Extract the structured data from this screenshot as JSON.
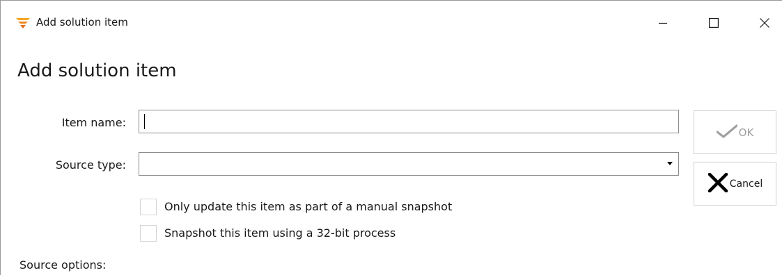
{
  "window": {
    "title": "Add solution item",
    "app_icon": "solarwinds-logo-icon",
    "controls": {
      "minimize": "minimize-icon",
      "maximize": "maximize-icon",
      "close": "close-icon"
    }
  },
  "dialog": {
    "heading": "Add solution item"
  },
  "form": {
    "item_name_label": "Item name:",
    "item_name_value": "",
    "source_type_label": "Source type:",
    "source_type_value": "",
    "checkbox_manual_snapshot": {
      "label": "Only update this item as part of a manual snapshot",
      "checked": false
    },
    "checkbox_32bit": {
      "label": "Snapshot this item using a 32-bit process",
      "checked": false
    },
    "source_options_label": "Source options:"
  },
  "buttons": {
    "ok_label": "OK",
    "ok_icon": "checkmark-icon",
    "ok_enabled": false,
    "cancel_label": "Cancel",
    "cancel_icon": "x-icon"
  },
  "colors": {
    "brand_orange": "#f5a623",
    "disabled_text": "#a0a0a0"
  }
}
